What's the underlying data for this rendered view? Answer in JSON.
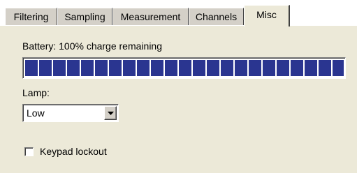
{
  "tabs": [
    {
      "label": "Filtering",
      "active": false
    },
    {
      "label": "Sampling",
      "active": false
    },
    {
      "label": "Measurement",
      "active": false
    },
    {
      "label": "Channels",
      "active": false
    },
    {
      "label": "Misc",
      "active": true
    }
  ],
  "misc": {
    "battery_label": "Battery: 100% charge remaining",
    "battery_level": 1.0,
    "progress_color": "#2a3590",
    "lamp_label": "Lamp:",
    "lamp_value": "Low",
    "lamp_dropdown_icon": "chevron-down-icon",
    "keypad_lockout_label": "Keypad lockout",
    "keypad_lockout_checked": false
  }
}
